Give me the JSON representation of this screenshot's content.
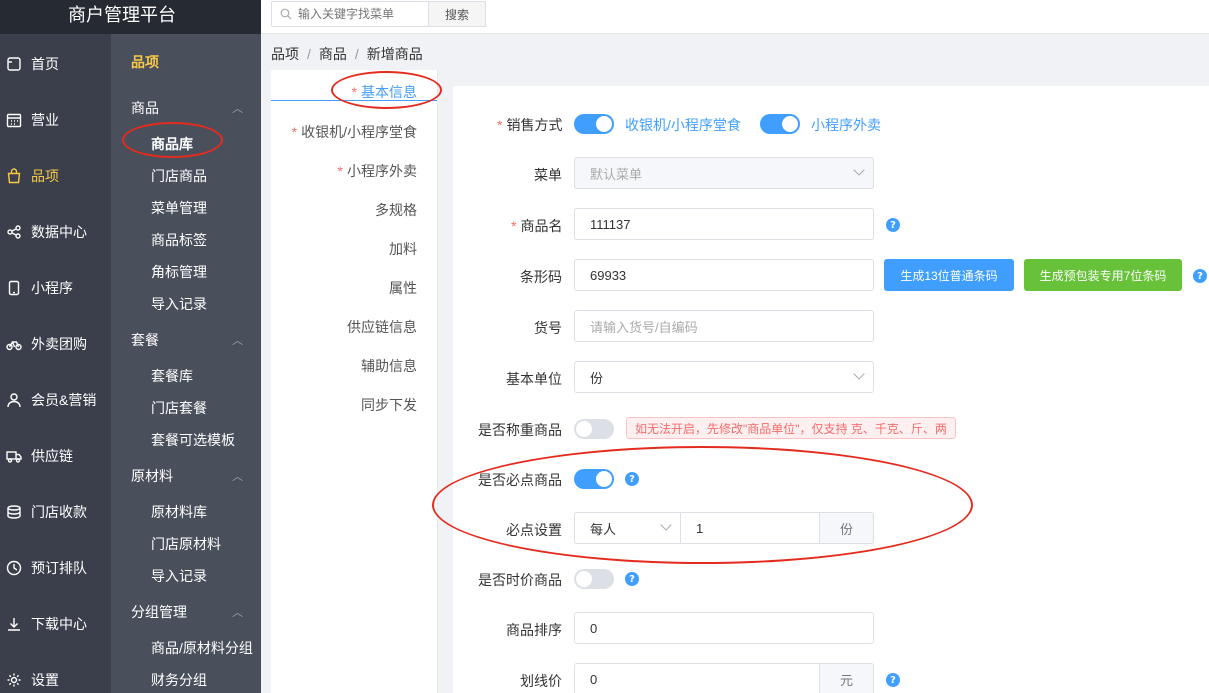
{
  "app": {
    "title": "商户管理平台"
  },
  "nav1": [
    {
      "label": "首页",
      "icon": "home-icon"
    },
    {
      "label": "营业",
      "icon": "calendar-icon"
    },
    {
      "label": "品项",
      "icon": "bag-icon",
      "active": true
    },
    {
      "label": "数据中心",
      "icon": "share-icon"
    },
    {
      "label": "小程序",
      "icon": "phone-icon"
    },
    {
      "label": "外卖团购",
      "icon": "bike-icon"
    },
    {
      "label": "会员&营销",
      "icon": "user-icon"
    },
    {
      "label": "供应链",
      "icon": "truck-icon"
    },
    {
      "label": "门店收款",
      "icon": "coins-icon"
    },
    {
      "label": "预订排队",
      "icon": "clock-icon"
    },
    {
      "label": "下载中心",
      "icon": "download-icon"
    },
    {
      "label": "设置",
      "icon": "gear-icon"
    }
  ],
  "nav2": {
    "top": "品项",
    "groups": [
      {
        "label": "商品",
        "items": [
          "商品库",
          "门店商品",
          "菜单管理",
          "商品标签",
          "角标管理",
          "导入记录"
        ]
      },
      {
        "label": "套餐",
        "items": [
          "套餐库",
          "门店套餐",
          "套餐可选模板"
        ]
      },
      {
        "label": "原材料",
        "items": [
          "原材料库",
          "门店原材料",
          "导入记录"
        ]
      },
      {
        "label": "分组管理",
        "items": [
          "商品/原材料分组",
          "财务分组"
        ]
      }
    ]
  },
  "search": {
    "placeholder": "输入关键字找菜单",
    "button": "搜索"
  },
  "breadcrumb": [
    "品项",
    "商品",
    "新增商品"
  ],
  "steps": [
    {
      "label": "基本信息",
      "required": true,
      "active": true
    },
    {
      "label": "收银机/小程序堂食",
      "required": true
    },
    {
      "label": "小程序外卖",
      "required": true
    },
    {
      "label": "多规格"
    },
    {
      "label": "加料"
    },
    {
      "label": "属性"
    },
    {
      "label": "供应链信息"
    },
    {
      "label": "辅助信息"
    },
    {
      "label": "同步下发"
    }
  ],
  "form": {
    "sale_mode_label": "销售方式",
    "sale_mode_options": [
      {
        "label": "收银机/小程序堂食",
        "on": true
      },
      {
        "label": "小程序外卖",
        "on": true
      }
    ],
    "menu_label": "菜单",
    "menu_value": "默认菜单",
    "name_label": "商品名",
    "name_value": "111137",
    "barcode_label": "条形码",
    "barcode_value": "69933",
    "barcode_btn1": "生成13位普通条码",
    "barcode_btn2": "生成预包装专用7位条码",
    "sku_label": "货号",
    "sku_placeholder": "请输入货号/自编码",
    "unit_label": "基本单位",
    "unit_value": "份",
    "weigh_label": "是否称重商品",
    "weigh_on": false,
    "weigh_warning": "如无法开启，先修改\"商品单位\"，仅支持 克、千克、斤、两",
    "must_label": "是否必点商品",
    "must_on": true,
    "must_setting_label": "必点设置",
    "must_setting_scope": "每人",
    "must_setting_qty": "1",
    "must_setting_unit": "份",
    "timeprice_label": "是否时价商品",
    "timeprice_on": false,
    "sort_label": "商品排序",
    "sort_value": "0",
    "strike_label": "划线价",
    "strike_value": "0",
    "strike_unit": "元"
  },
  "colors": {
    "accent": "#409eff",
    "green": "#67c23a",
    "nav_dark": "#3a3f4b",
    "nav_mid": "#4a4f5c",
    "nav_active": "#f7c948",
    "annotation": "#e52b1e",
    "danger": "#f56c6c"
  }
}
